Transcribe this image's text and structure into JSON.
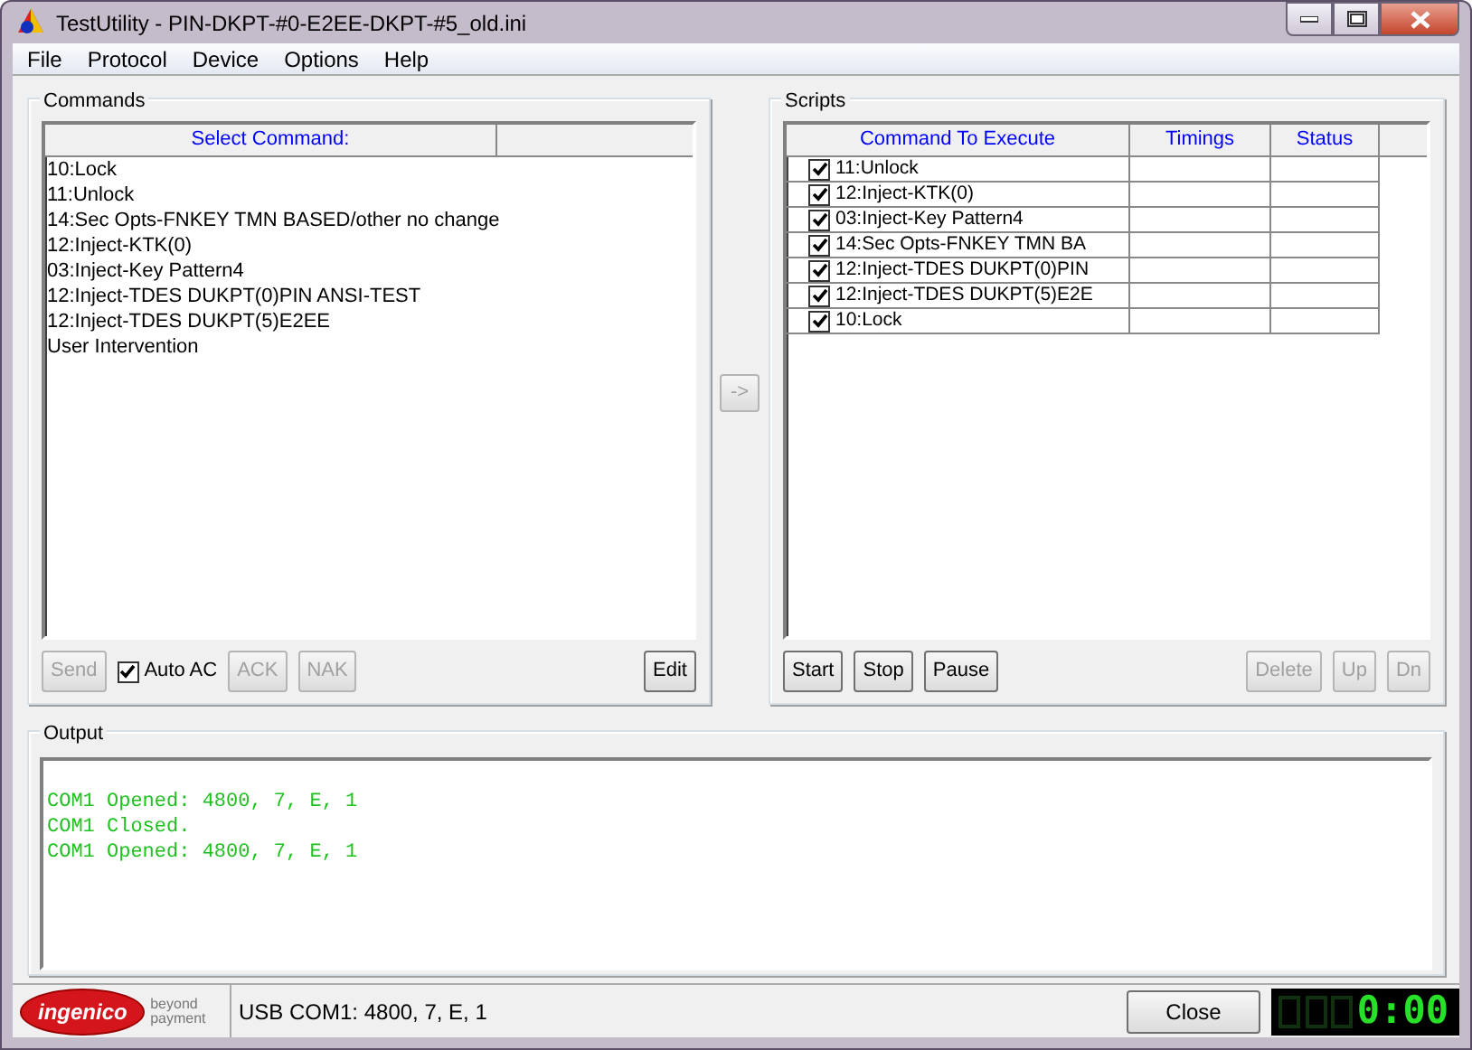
{
  "window": {
    "title": "TestUtility - PIN-DKPT-#0-E2EE-DKPT-#5_old.ini"
  },
  "menu": [
    "File",
    "Protocol",
    "Device",
    "Options",
    "Help"
  ],
  "commands": {
    "title": "Commands",
    "column": "Select Command:",
    "items": [
      "10:Lock",
      "11:Unlock",
      "14:Sec Opts-FNKEY TMN BASED/other no change",
      "12:Inject-KTK(0)",
      "03:Inject-Key Pattern4",
      "12:Inject-TDES DUKPT(0)PIN ANSI-TEST",
      "12:Inject-TDES DUKPT(5)E2EE",
      "User Intervention"
    ],
    "controls": [
      {
        "kind": "button",
        "label": "Send",
        "disabled": true
      },
      {
        "kind": "checkbox",
        "label": "Auto AC",
        "checked": true
      },
      {
        "kind": "button",
        "label": "ACK",
        "disabled": true
      },
      {
        "kind": "button",
        "label": "NAK",
        "disabled": true
      },
      {
        "kind": "spacer"
      },
      {
        "kind": "button",
        "label": "Edit",
        "disabled": false
      }
    ]
  },
  "transfer_button": {
    "label": "->",
    "disabled": true
  },
  "scripts": {
    "title": "Scripts",
    "columns": [
      "Command To Execute",
      "Timings",
      "Status"
    ],
    "rows": [
      {
        "command": "11:Unlock",
        "checked": true
      },
      {
        "command": "12:Inject-KTK(0)",
        "checked": true
      },
      {
        "command": "03:Inject-Key Pattern4",
        "checked": true
      },
      {
        "command": "14:Sec Opts-FNKEY TMN BA",
        "checked": true
      },
      {
        "command": "12:Inject-TDES DUKPT(0)PIN",
        "checked": true
      },
      {
        "command": "12:Inject-TDES DUKPT(5)E2E",
        "checked": true
      },
      {
        "command": "10:Lock",
        "checked": true
      }
    ],
    "controls": [
      {
        "kind": "button",
        "label": "Start",
        "disabled": false
      },
      {
        "kind": "button",
        "label": "Stop",
        "disabled": false
      },
      {
        "kind": "button",
        "label": "Pause",
        "disabled": false
      },
      {
        "kind": "spacer"
      },
      {
        "kind": "button",
        "label": "Delete",
        "disabled": true
      },
      {
        "kind": "button",
        "label": "Up",
        "disabled": true
      },
      {
        "kind": "button",
        "label": "Dn",
        "disabled": true
      }
    ]
  },
  "output": {
    "title": "Output",
    "lines": [
      "COM1 Opened: 4800, 7, E, 1",
      "COM1 Closed.",
      "COM1 Opened: 4800, 7, E, 1"
    ]
  },
  "status_bar": {
    "logo": "ingenico",
    "tagline": "beyond payment",
    "port": "USB COM1: 4800, 7, E, 1",
    "close_button": "Close",
    "timer": "0:00"
  }
}
